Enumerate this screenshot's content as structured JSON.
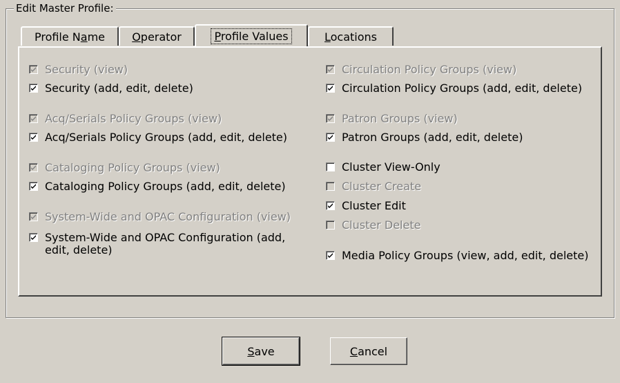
{
  "group_title": "Edit  Master Profile:",
  "tabs": [
    {
      "pre": "Profile N",
      "u": "a",
      "post": "me"
    },
    {
      "pre": "",
      "u": "O",
      "post": "perator"
    },
    {
      "pre": "",
      "u": "P",
      "post": "rofile Values"
    },
    {
      "pre": "",
      "u": "L",
      "post": "ocations"
    }
  ],
  "active_tab": "Profile Values",
  "left_column": [
    {
      "label": "Security (view)",
      "checked": true,
      "disabled": true
    },
    {
      "label": "Security (add, edit, delete)",
      "checked": true,
      "disabled": false
    },
    {
      "label": "Acq/Serials Policy Groups (view)",
      "checked": true,
      "disabled": true
    },
    {
      "label": "Acq/Serials Policy Groups (add, edit, delete)",
      "checked": true,
      "disabled": false
    },
    {
      "label": "Cataloging Policy Groups (view)",
      "checked": true,
      "disabled": true
    },
    {
      "label": "Cataloging Policy Groups (add, edit, delete)",
      "checked": true,
      "disabled": false
    },
    {
      "label": "System-Wide and OPAC Configuration (view)",
      "checked": true,
      "disabled": true
    },
    {
      "label": "System-Wide and OPAC Configuration (add,",
      "label2": "edit, delete)",
      "checked": true,
      "disabled": false
    }
  ],
  "right_column": [
    {
      "label": "Circulation Policy Groups (view)",
      "checked": true,
      "disabled": true
    },
    {
      "label": "Circulation Policy Groups (add, edit, delete)",
      "checked": true,
      "disabled": false
    },
    {
      "label": "Patron Groups (view)",
      "checked": true,
      "disabled": true
    },
    {
      "label": "Patron Groups (add, edit, delete)",
      "checked": true,
      "disabled": false
    },
    {
      "label": "Cluster View-Only",
      "checked": false,
      "disabled": false
    },
    {
      "label": "Cluster Create",
      "checked": false,
      "disabled": true
    },
    {
      "label": "Cluster Edit",
      "checked": true,
      "disabled": false
    },
    {
      "label": "Cluster Delete",
      "checked": false,
      "disabled": true
    },
    {
      "label": "Media Policy Groups (view, add, edit, delete)",
      "checked": true,
      "disabled": false
    }
  ],
  "buttons": {
    "save": {
      "u": "S",
      "rest": "ave"
    },
    "cancel": {
      "u": "C",
      "rest": "ancel"
    }
  }
}
